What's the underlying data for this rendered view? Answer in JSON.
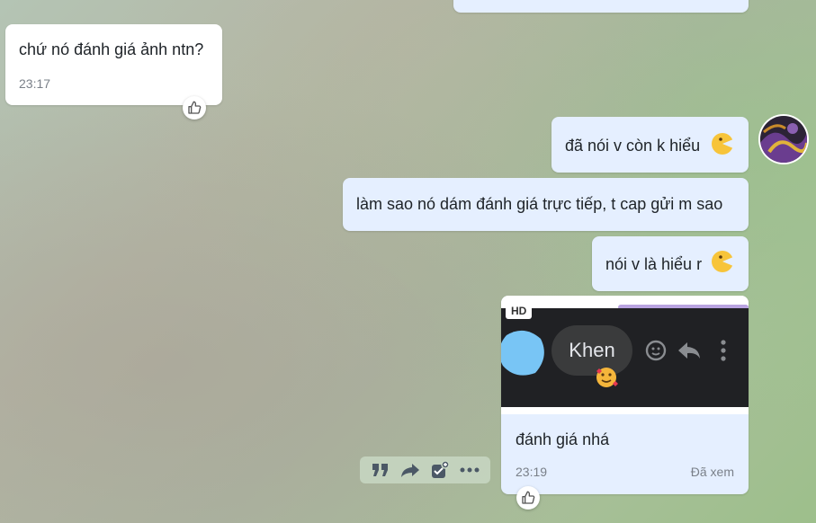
{
  "messages": [
    {
      "id": "m1",
      "side": "received",
      "text": "chứ nó đánh giá ảnh ntn?",
      "time": "23:17"
    },
    {
      "id": "m2",
      "side": "sent",
      "text": "đã nói v còn k hiểu",
      "emoji": "pacman-grin-emoji"
    },
    {
      "id": "m3",
      "side": "sent",
      "text": "làm sao nó dám đánh giá trực tiếp, t cap gửi m sao"
    },
    {
      "id": "m4",
      "side": "sent",
      "text": "nói v là hiểu r",
      "emoji": "pacman-grin-emoji"
    },
    {
      "id": "m5",
      "side": "sent",
      "type": "image",
      "image_badge": "HD",
      "image_text": "Khen",
      "caption": "đánh giá nhá",
      "time": "23:19",
      "status": "Đã xem"
    }
  ],
  "toolbar": {
    "icons": [
      "quote-icon",
      "forward-icon",
      "add-todo-icon",
      "more-icon"
    ]
  },
  "colors": {
    "sent_bubble": "#e5efff",
    "received_bubble": "#ffffff",
    "time_text": "#7a8089"
  }
}
